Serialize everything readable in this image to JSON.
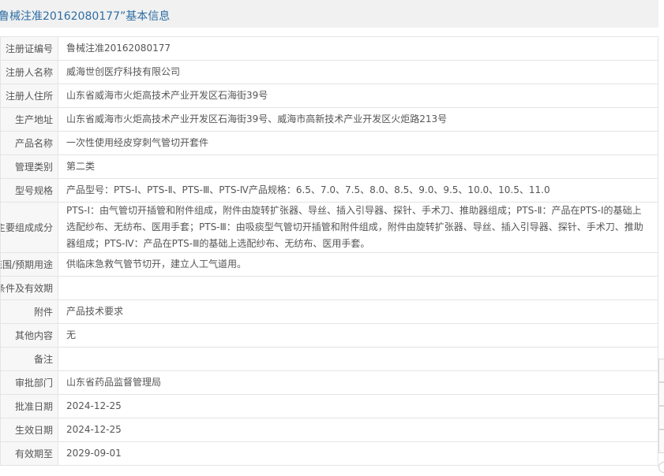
{
  "header": {
    "title": "鲁械注准20162080177”基本信息"
  },
  "rows": [
    {
      "label": "注册证编号",
      "value": "鲁械注准20162080177"
    },
    {
      "label": "注册人名称",
      "value": "威海世创医疗科技有限公司"
    },
    {
      "label": "注册人住所",
      "value": "山东省威海市火炬高技术产业开发区石海街39号"
    },
    {
      "label": "生产地址",
      "value": "山东省威海市火炬高技术产业开发区石海街39号、威海市高新技术产业开发区火炬路213号"
    },
    {
      "label": "产品名称",
      "value": "一次性使用经皮穿刺气管切开套件"
    },
    {
      "label": "管理类别",
      "value": "第二类"
    },
    {
      "label": "型号规格",
      "value": "产品型号：PTS-Ⅰ、PTS-Ⅱ、PTS-Ⅲ、PTS-Ⅳ产品规格：6.5、7.0、7.5、8.0、8.5、9.0、9.5、10.0、10.5、11.0"
    },
    {
      "label": "主要组成成分",
      "value": "PTS-Ⅰ：由气管切开插管和附件组成，附件由旋转扩张器、导丝、插入引导器、探针、手术刀、推助器组成；PTS-Ⅱ：产品在PTS-Ⅰ的基础上选配纱布、无纺布、医用手套；PTS-Ⅲ：由吸痰型气管切开插管和附件组成，附件由旋转扩张器、导丝、插入引导器、探针、手术刀、推助器组成；PTS-Ⅳ：产品在PTS-Ⅲ的基础上选配纱布、无纺布、医用手套。"
    },
    {
      "label": "适用范围/预期用途",
      "value": "供临床急救气管节切开，建立人工气道用。"
    },
    {
      "label": "产品储存条件及有效期",
      "value": ""
    },
    {
      "label": "附件",
      "value": "产品技术要求"
    },
    {
      "label": "其他内容",
      "value": "无"
    },
    {
      "label": "备注",
      "value": ""
    },
    {
      "label": "审批部门",
      "value": "山东省药品监督管理局"
    },
    {
      "label": "批准日期",
      "value": "2024-12-25"
    },
    {
      "label": "生效日期",
      "value": "2024-12-25"
    },
    {
      "label": "有效期至",
      "value": "2029-09-01"
    }
  ],
  "colors": {
    "title_text": "#2e6da4",
    "title_bar_bg": "#f1f1f1",
    "label_bg": "#f7f7f7",
    "border": "#e4e4e4",
    "text": "#555555"
  }
}
